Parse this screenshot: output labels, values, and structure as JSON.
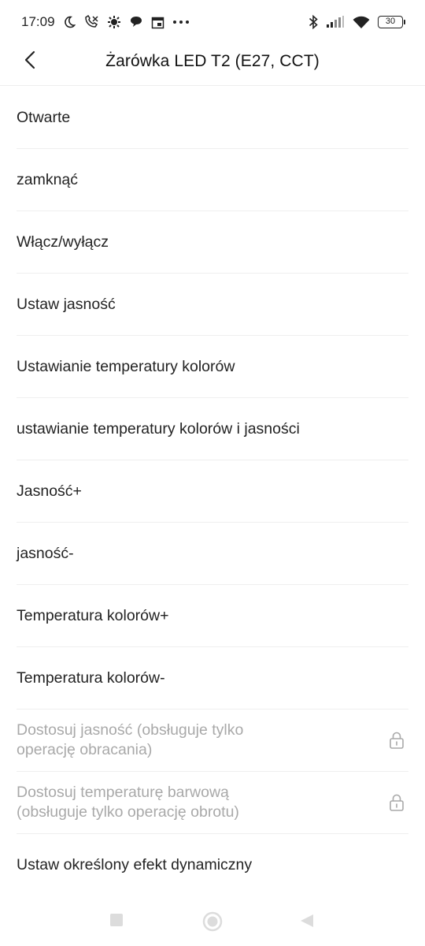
{
  "status_bar": {
    "time": "17:09",
    "battery": "30",
    "left_icons": [
      "moon-icon",
      "missed-call-icon",
      "gear-icon",
      "chat-bubble-icon",
      "calendar-icon",
      "more-dots-icon"
    ],
    "right_icons": [
      "bluetooth-icon",
      "signal-icon",
      "wifi-icon",
      "battery-icon"
    ]
  },
  "header": {
    "title": "Żarówka LED T2 (E27, CCT)",
    "back_icon": "chevron-left-icon"
  },
  "actions": [
    {
      "label": "Otwarte",
      "locked": false
    },
    {
      "label": "zamknąć",
      "locked": false
    },
    {
      "label": "Włącz/wyłącz",
      "locked": false
    },
    {
      "label": "Ustaw jasność",
      "locked": false
    },
    {
      "label": "Ustawianie temperatury kolorów",
      "locked": false
    },
    {
      "label": "ustawianie temperatury kolorów i jasności",
      "locked": false
    },
    {
      "label": "Jasność+",
      "locked": false
    },
    {
      "label": "jasność-",
      "locked": false
    },
    {
      "label": "Temperatura kolorów+",
      "locked": false
    },
    {
      "label": "Temperatura kolorów-",
      "locked": false
    },
    {
      "label_line1": "Dostosuj jasność (obsługuje tylko",
      "label_line2": "operację obracania)",
      "locked": true
    },
    {
      "label_line1": "Dostosuj temperaturę barwową",
      "label_line2": "(obsługuje tylko operację obrotu)",
      "locked": true
    },
    {
      "label": "Ustaw określony efekt dynamiczny",
      "locked": false
    }
  ],
  "colors": {
    "text": "#232323",
    "disabled_text": "#a9a9a9",
    "divider": "#efefef",
    "nav_icons": "#dcdcdc"
  },
  "nav_bar": [
    "square-recents-icon",
    "circle-home-icon",
    "triangle-back-icon"
  ]
}
